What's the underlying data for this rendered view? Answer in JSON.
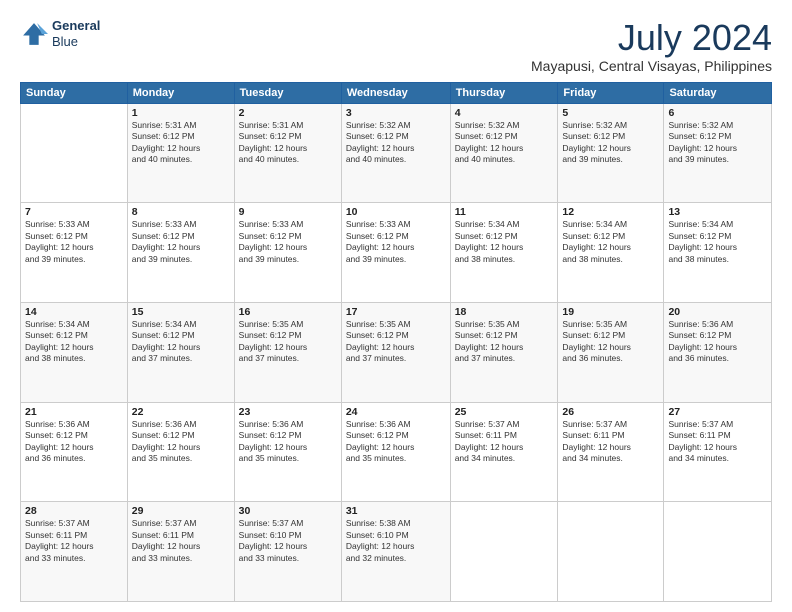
{
  "logo": {
    "line1": "General",
    "line2": "Blue"
  },
  "header": {
    "month": "July 2024",
    "location": "Mayapusi, Central Visayas, Philippines"
  },
  "weekdays": [
    "Sunday",
    "Monday",
    "Tuesday",
    "Wednesday",
    "Thursday",
    "Friday",
    "Saturday"
  ],
  "weeks": [
    [
      {
        "day": "",
        "info": ""
      },
      {
        "day": "1",
        "info": "Sunrise: 5:31 AM\nSunset: 6:12 PM\nDaylight: 12 hours\nand 40 minutes."
      },
      {
        "day": "2",
        "info": "Sunrise: 5:31 AM\nSunset: 6:12 PM\nDaylight: 12 hours\nand 40 minutes."
      },
      {
        "day": "3",
        "info": "Sunrise: 5:32 AM\nSunset: 6:12 PM\nDaylight: 12 hours\nand 40 minutes."
      },
      {
        "day": "4",
        "info": "Sunrise: 5:32 AM\nSunset: 6:12 PM\nDaylight: 12 hours\nand 40 minutes."
      },
      {
        "day": "5",
        "info": "Sunrise: 5:32 AM\nSunset: 6:12 PM\nDaylight: 12 hours\nand 39 minutes."
      },
      {
        "day": "6",
        "info": "Sunrise: 5:32 AM\nSunset: 6:12 PM\nDaylight: 12 hours\nand 39 minutes."
      }
    ],
    [
      {
        "day": "7",
        "info": "Sunrise: 5:33 AM\nSunset: 6:12 PM\nDaylight: 12 hours\nand 39 minutes."
      },
      {
        "day": "8",
        "info": "Sunrise: 5:33 AM\nSunset: 6:12 PM\nDaylight: 12 hours\nand 39 minutes."
      },
      {
        "day": "9",
        "info": "Sunrise: 5:33 AM\nSunset: 6:12 PM\nDaylight: 12 hours\nand 39 minutes."
      },
      {
        "day": "10",
        "info": "Sunrise: 5:33 AM\nSunset: 6:12 PM\nDaylight: 12 hours\nand 39 minutes."
      },
      {
        "day": "11",
        "info": "Sunrise: 5:34 AM\nSunset: 6:12 PM\nDaylight: 12 hours\nand 38 minutes."
      },
      {
        "day": "12",
        "info": "Sunrise: 5:34 AM\nSunset: 6:12 PM\nDaylight: 12 hours\nand 38 minutes."
      },
      {
        "day": "13",
        "info": "Sunrise: 5:34 AM\nSunset: 6:12 PM\nDaylight: 12 hours\nand 38 minutes."
      }
    ],
    [
      {
        "day": "14",
        "info": "Sunrise: 5:34 AM\nSunset: 6:12 PM\nDaylight: 12 hours\nand 38 minutes."
      },
      {
        "day": "15",
        "info": "Sunrise: 5:34 AM\nSunset: 6:12 PM\nDaylight: 12 hours\nand 37 minutes."
      },
      {
        "day": "16",
        "info": "Sunrise: 5:35 AM\nSunset: 6:12 PM\nDaylight: 12 hours\nand 37 minutes."
      },
      {
        "day": "17",
        "info": "Sunrise: 5:35 AM\nSunset: 6:12 PM\nDaylight: 12 hours\nand 37 minutes."
      },
      {
        "day": "18",
        "info": "Sunrise: 5:35 AM\nSunset: 6:12 PM\nDaylight: 12 hours\nand 37 minutes."
      },
      {
        "day": "19",
        "info": "Sunrise: 5:35 AM\nSunset: 6:12 PM\nDaylight: 12 hours\nand 36 minutes."
      },
      {
        "day": "20",
        "info": "Sunrise: 5:36 AM\nSunset: 6:12 PM\nDaylight: 12 hours\nand 36 minutes."
      }
    ],
    [
      {
        "day": "21",
        "info": "Sunrise: 5:36 AM\nSunset: 6:12 PM\nDaylight: 12 hours\nand 36 minutes."
      },
      {
        "day": "22",
        "info": "Sunrise: 5:36 AM\nSunset: 6:12 PM\nDaylight: 12 hours\nand 35 minutes."
      },
      {
        "day": "23",
        "info": "Sunrise: 5:36 AM\nSunset: 6:12 PM\nDaylight: 12 hours\nand 35 minutes."
      },
      {
        "day": "24",
        "info": "Sunrise: 5:36 AM\nSunset: 6:12 PM\nDaylight: 12 hours\nand 35 minutes."
      },
      {
        "day": "25",
        "info": "Sunrise: 5:37 AM\nSunset: 6:11 PM\nDaylight: 12 hours\nand 34 minutes."
      },
      {
        "day": "26",
        "info": "Sunrise: 5:37 AM\nSunset: 6:11 PM\nDaylight: 12 hours\nand 34 minutes."
      },
      {
        "day": "27",
        "info": "Sunrise: 5:37 AM\nSunset: 6:11 PM\nDaylight: 12 hours\nand 34 minutes."
      }
    ],
    [
      {
        "day": "28",
        "info": "Sunrise: 5:37 AM\nSunset: 6:11 PM\nDaylight: 12 hours\nand 33 minutes."
      },
      {
        "day": "29",
        "info": "Sunrise: 5:37 AM\nSunset: 6:11 PM\nDaylight: 12 hours\nand 33 minutes."
      },
      {
        "day": "30",
        "info": "Sunrise: 5:37 AM\nSunset: 6:10 PM\nDaylight: 12 hours\nand 33 minutes."
      },
      {
        "day": "31",
        "info": "Sunrise: 5:38 AM\nSunset: 6:10 PM\nDaylight: 12 hours\nand 32 minutes."
      },
      {
        "day": "",
        "info": ""
      },
      {
        "day": "",
        "info": ""
      },
      {
        "day": "",
        "info": ""
      }
    ]
  ]
}
